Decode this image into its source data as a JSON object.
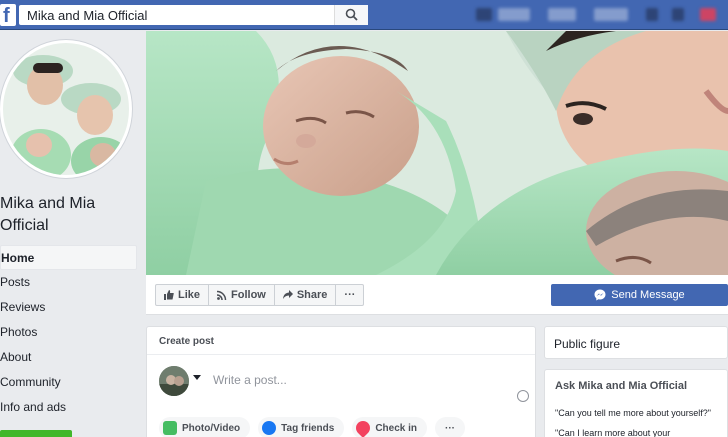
{
  "search": {
    "value": "Mika and Mia Official"
  },
  "icons": {
    "logo": "facebook-logo-icon",
    "search": "search-icon"
  },
  "page": {
    "name": "Mika and Mia Official"
  },
  "nav": {
    "items": [
      {
        "label": "Home",
        "active": true
      },
      {
        "label": "Posts"
      },
      {
        "label": "Reviews"
      },
      {
        "label": "Photos"
      },
      {
        "label": "About"
      },
      {
        "label": "Community"
      },
      {
        "label": "Info and ads"
      }
    ]
  },
  "actions": {
    "like": "Like",
    "follow": "Follow",
    "share": "Share",
    "more": "···",
    "send_message": "Send Message"
  },
  "create_post": {
    "title": "Create post",
    "placeholder": "Write a post...",
    "tools": [
      {
        "label": "Photo/Video",
        "color": "#45bd62"
      },
      {
        "label": "Tag friends",
        "color": "#1877f2"
      },
      {
        "label": "Check in",
        "color": "#f3425f"
      },
      {
        "label": "···",
        "color": "#bec3c9"
      }
    ]
  },
  "sidebar": {
    "category": "Public figure",
    "ask_title": "Ask Mika and Mia Official",
    "questions": [
      "\"Can you tell me more about yourself?\"",
      "\"Can I learn more about your"
    ]
  },
  "colors": {
    "brand": "#4267b2",
    "accent_green": "#42b72a"
  }
}
